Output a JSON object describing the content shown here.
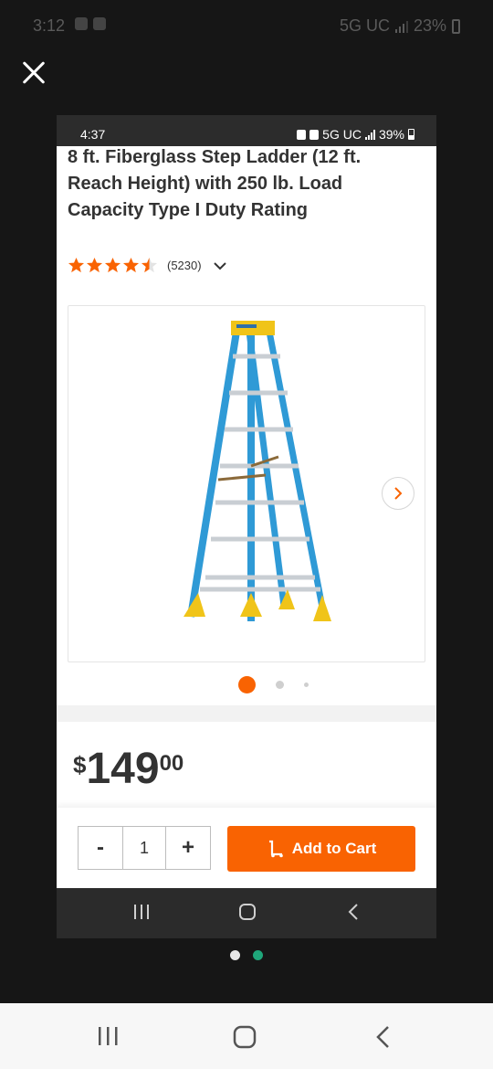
{
  "outer_status": {
    "time": "3:12",
    "network": "5G UC",
    "battery": "23%"
  },
  "inner_status": {
    "time": "4:37",
    "network": "5G UC",
    "battery": "39%"
  },
  "product": {
    "title": "8 ft. Fiberglass Step Ladder (12 ft. Reach Height) with 250 lb. Load Capacity Type I Duty Rating",
    "rating": 4.5,
    "review_count": "(5230)",
    "price_currency": "$",
    "price_dollars": "149",
    "price_cents": "00"
  },
  "carousel": {
    "total_images": 3,
    "current_index": 1
  },
  "cart": {
    "minus_label": "-",
    "quantity": "1",
    "plus_label": "+",
    "add_to_cart_label": "Add to Cart"
  },
  "gallery_pager": {
    "total_pages": 2,
    "current_page": 2
  },
  "colors": {
    "accent_orange": "#f96302",
    "ladder_blue": "#2f9ad6",
    "ladder_yellow": "#f0c419",
    "page_dot_active": "#1fa67a"
  }
}
